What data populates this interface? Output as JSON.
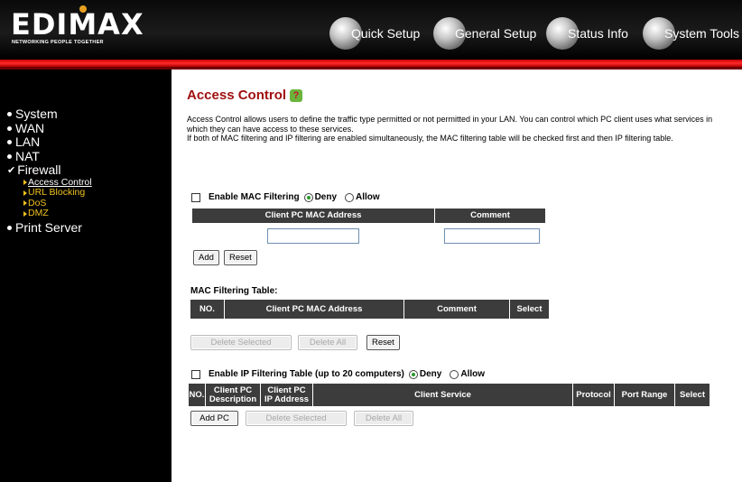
{
  "header": {
    "logo_text": "EDIMAX",
    "logo_tagline": "NETWORKING PEOPLE TOGETHER",
    "nav": [
      {
        "label": "Quick Setup",
        "icon": "quick-setup-icon"
      },
      {
        "label": "General Setup",
        "icon": "general-setup-icon"
      },
      {
        "label": "Status Info",
        "icon": "status-info-icon"
      },
      {
        "label": "System Tools",
        "icon": "system-tools-icon"
      }
    ]
  },
  "colors": {
    "accent_red": "#e00000",
    "title_red": "#a01010",
    "submenu_yellow": "#f0c020",
    "table_header": "#3c3c3c"
  },
  "sidebar": {
    "items": [
      {
        "label": "System"
      },
      {
        "label": "WAN"
      },
      {
        "label": "LAN"
      },
      {
        "label": "NAT"
      },
      {
        "label": "Firewall"
      },
      {
        "label": "Print Server"
      }
    ],
    "firewall_sub": [
      {
        "label": "Access Control",
        "active": true
      },
      {
        "label": "URL Blocking"
      },
      {
        "label": "DoS"
      },
      {
        "label": "DMZ"
      }
    ]
  },
  "page": {
    "title": "Access Control",
    "help_icon": "?",
    "description_1": "Access Control allows users to define the traffic type permitted or not permitted in your LAN. You can control which PC client uses what services in which they can have access to these services.",
    "description_2": "If both of MAC filtering and IP filtering are enabled simultaneously, the MAC filtering table will be checked first and then IP filtering table."
  },
  "mac_filter": {
    "enable_label": "Enable MAC Filtering",
    "deny_label": "Deny",
    "allow_label": "Allow",
    "mode": "Deny",
    "col_mac": "Client PC MAC Address",
    "col_comment": "Comment",
    "mac_value": "",
    "comment_value": "",
    "add_button": "Add",
    "reset_button": "Reset"
  },
  "mac_table": {
    "title": "MAC Filtering Table:",
    "columns": [
      "NO.",
      "Client PC MAC Address",
      "Comment",
      "Select"
    ],
    "delete_selected": "Delete Selected",
    "delete_all": "Delete All",
    "reset": "Reset"
  },
  "ip_filter": {
    "enable_label": "Enable IP Filtering Table (up to 20 computers)",
    "deny_label": "Deny",
    "allow_label": "Allow",
    "mode": "Deny",
    "columns": {
      "no": "NO.",
      "desc_1": "Client PC",
      "desc_2": "Description",
      "ip_1": "Client PC",
      "ip_2": "IP Address",
      "service": "Client Service",
      "protocol": "Protocol",
      "port_range": "Port Range",
      "select": "Select"
    },
    "add_pc": "Add PC",
    "delete_selected": "Delete Selected",
    "delete_all": "Delete All"
  }
}
